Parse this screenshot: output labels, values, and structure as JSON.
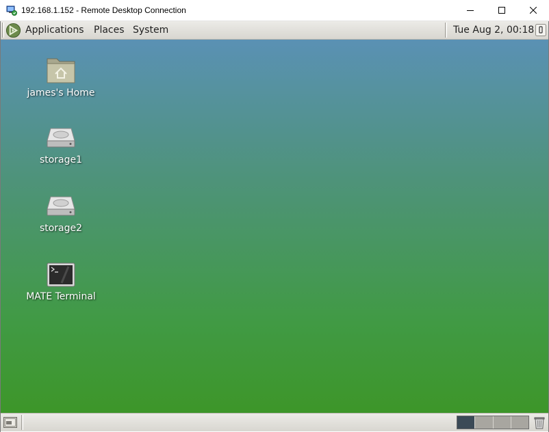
{
  "window": {
    "title": "192.168.1.152 - Remote Desktop Connection",
    "icons": {
      "app": "remote-desktop-icon",
      "minimize": "minimize-icon",
      "maximize": "maximize-icon",
      "close": "close-icon"
    }
  },
  "top_panel": {
    "logo_icon": "mate-logo-icon",
    "menus": [
      {
        "label": "Applications"
      },
      {
        "label": "Places"
      },
      {
        "label": "System"
      }
    ],
    "clock": "Tue Aug  2, 00:18",
    "show_icon": "notification-icon"
  },
  "desktop": {
    "icons": [
      {
        "label": "james's Home",
        "icon": "home-folder-icon"
      },
      {
        "label": "storage1",
        "icon": "hard-drive-icon"
      },
      {
        "label": "storage2",
        "icon": "hard-drive-icon"
      },
      {
        "label": "MATE Terminal",
        "icon": "terminal-icon"
      }
    ],
    "background_colors": [
      "#5a91b4",
      "#4e9379",
      "#419a45",
      "#3d9629"
    ]
  },
  "bottom_panel": {
    "show_desktop_icon": "show-desktop-icon",
    "workspaces": {
      "count": 4,
      "active": 1
    },
    "trash_icon": "trash-icon"
  }
}
